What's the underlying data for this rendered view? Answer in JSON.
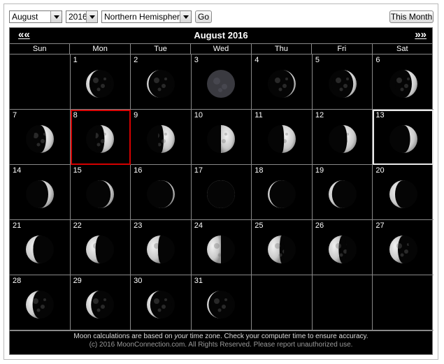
{
  "controls": {
    "month": "August",
    "year": "2016",
    "hemisphere": "Northern Hemisphere",
    "go_label": "Go",
    "this_month_label": "This Month"
  },
  "calendar": {
    "title": "August 2016",
    "prev_label": "««",
    "next_label": "»»",
    "weekdays": [
      "Sun",
      "Mon",
      "Tue",
      "Wed",
      "Thu",
      "Fri",
      "Sat"
    ],
    "first_weekday_index": 1,
    "today_day": 8,
    "selected_day": 13,
    "days": [
      {
        "day": 1,
        "phase": 0.94
      },
      {
        "day": 2,
        "phase": 0.97
      },
      {
        "day": 3,
        "phase": 0.0
      },
      {
        "day": 4,
        "phase": 0.03
      },
      {
        "day": 5,
        "phase": 0.06
      },
      {
        "day": 6,
        "phase": 0.1
      },
      {
        "day": 7,
        "phase": 0.14
      },
      {
        "day": 8,
        "phase": 0.17
      },
      {
        "day": 9,
        "phase": 0.2
      },
      {
        "day": 10,
        "phase": 0.25
      },
      {
        "day": 11,
        "phase": 0.29
      },
      {
        "day": 12,
        "phase": 0.33
      },
      {
        "day": 13,
        "phase": 0.37
      },
      {
        "day": 14,
        "phase": 0.4
      },
      {
        "day": 15,
        "phase": 0.44
      },
      {
        "day": 16,
        "phase": 0.47
      },
      {
        "day": 17,
        "phase": 0.5
      },
      {
        "day": 18,
        "phase": 0.53
      },
      {
        "day": 19,
        "phase": 0.56
      },
      {
        "day": 20,
        "phase": 0.6
      },
      {
        "day": 21,
        "phase": 0.63
      },
      {
        "day": 22,
        "phase": 0.67
      },
      {
        "day": 23,
        "phase": 0.7
      },
      {
        "day": 24,
        "phase": 0.75
      },
      {
        "day": 25,
        "phase": 0.79
      },
      {
        "day": 26,
        "phase": 0.82
      },
      {
        "day": 27,
        "phase": 0.85
      },
      {
        "day": 28,
        "phase": 0.88
      },
      {
        "day": 29,
        "phase": 0.91
      },
      {
        "day": 30,
        "phase": 0.94
      },
      {
        "day": 31,
        "phase": 0.97
      }
    ]
  },
  "footer": {
    "line1_pre": "Moon calculations are based on ",
    "line1_em": "your",
    "line1_post": " time zone. Check your computer time to ensure accuracy.",
    "line2": "(c) 2016 MoonConnection.com. All Rights Reserved. Please report unauthorized use."
  },
  "icons": {
    "moon": "moon-phase-icon",
    "dropdown": "chevron-down-icon"
  },
  "colors": {
    "today_border": "#d40000",
    "selected_border": "#e8e8e8",
    "background": "#000000"
  }
}
